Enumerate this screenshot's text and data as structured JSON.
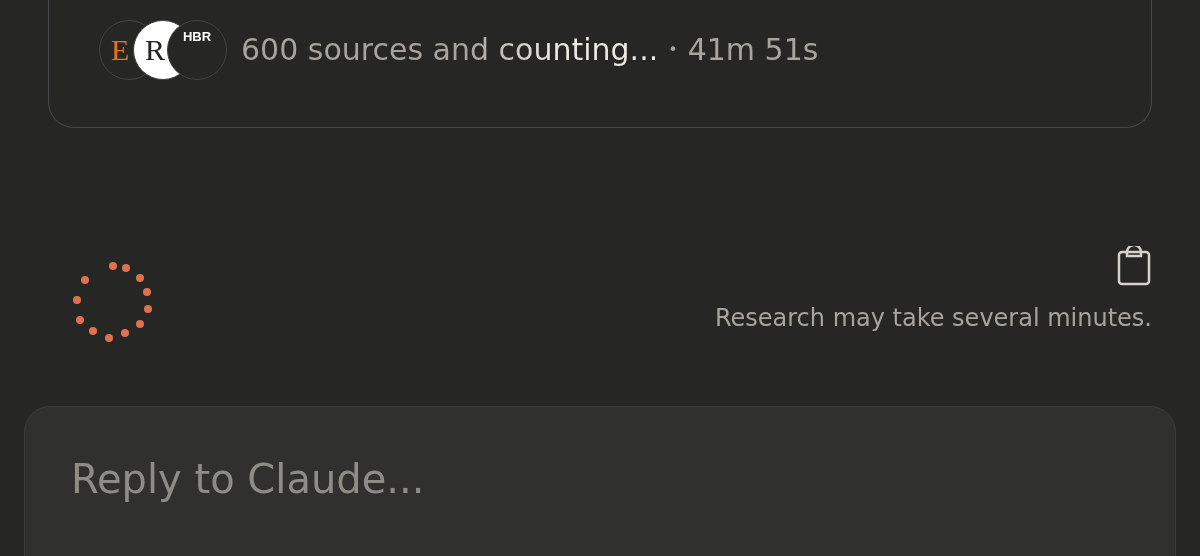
{
  "sources_card": {
    "favicons": [
      {
        "kind": "serif-e",
        "label": "E"
      },
      {
        "kind": "serif-r",
        "label": "R"
      },
      {
        "kind": "hbr",
        "label": "HBR"
      }
    ],
    "status": "600 sources and counting...",
    "separator": "•",
    "elapsed": "41m 51s"
  },
  "progress": {
    "note": "Research may take several minutes."
  },
  "reply": {
    "placeholder": "Reply to Claude..."
  }
}
